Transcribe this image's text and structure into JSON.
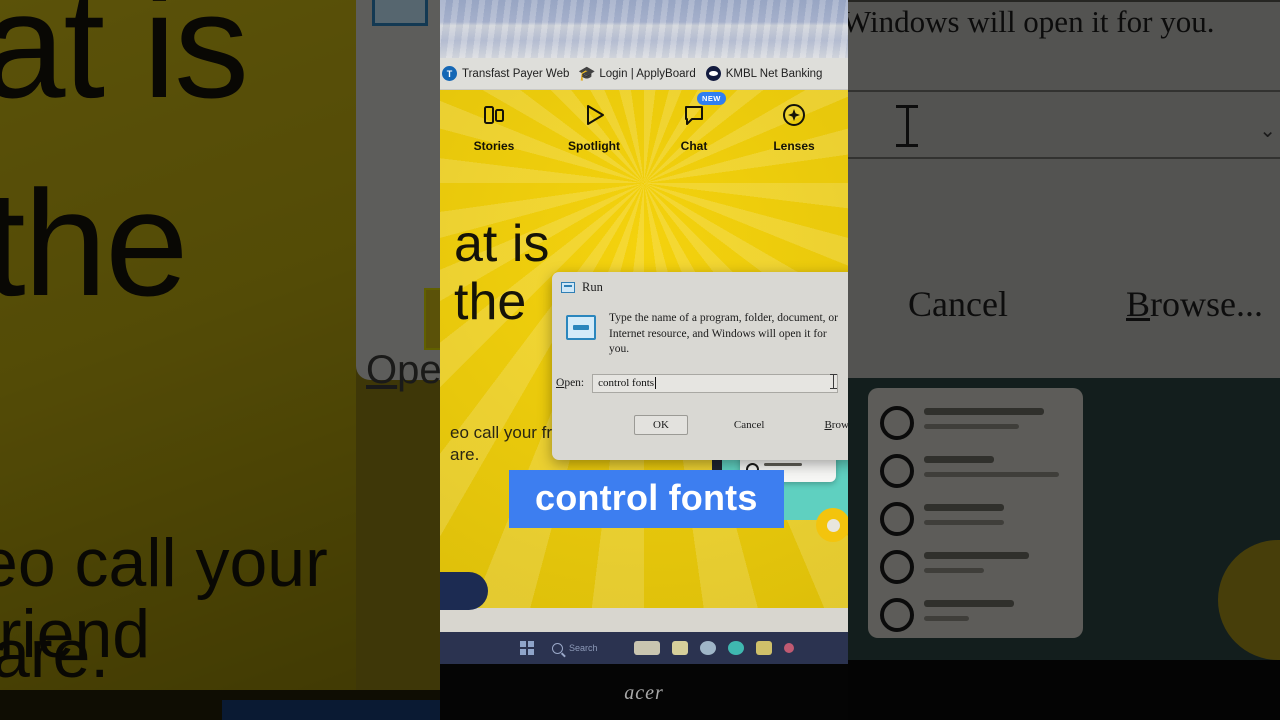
{
  "caption": {
    "text": "control fonts"
  },
  "browser": {
    "bookmarks": [
      {
        "label": "Transfast Payer Web",
        "icon": "transfast-favicon"
      },
      {
        "label": "Login | ApplyBoard",
        "icon": "applyboard-favicon"
      },
      {
        "label": "KMBL Net Banking",
        "icon": "kmbl-favicon"
      }
    ]
  },
  "snapchat": {
    "nav": [
      {
        "label": "Stories",
        "icon": "stories-icon",
        "badge": ""
      },
      {
        "label": "Spotlight",
        "icon": "spotlight-play-icon",
        "badge": ""
      },
      {
        "label": "Chat",
        "icon": "chat-bubble-icon",
        "badge": "NEW"
      },
      {
        "label": "Lenses",
        "icon": "lenses-sparkle-icon",
        "badge": ""
      }
    ],
    "hero_headline_line1": "at is",
    "hero_headline_line2": "the",
    "hero_sub_line1": "eo call your friends",
    "hero_sub_line2": "are.",
    "banner_text": "New! Snap, chat and video call your friends from your browser."
  },
  "run_dialog": {
    "title": "Run",
    "title_icon": "run-window-icon",
    "description_line1": "Type the name of a program, folder, document, or",
    "description_line2": "Internet resource, and Windows will open it for you.",
    "open_label": "Open:",
    "open_value": "control fonts",
    "buttons": {
      "ok": "OK",
      "cancel": "Cancel",
      "browse": "Browse..."
    }
  },
  "taskbar": {
    "start_icon": "windows-start-icon",
    "search_icon": "search-icon",
    "search_placeholder": "Search"
  },
  "laptop": {
    "brand": "acer"
  },
  "side_panels": {
    "left": {
      "word1": "at is",
      "word2": "the",
      "word3": "eo call your friend",
      "word4": "are.",
      "open_label": "Ope"
    },
    "right": {
      "line1": "Windows will open it for you.",
      "cancel": "Cancel",
      "browse": "Browse..."
    }
  },
  "colors": {
    "caption_bg": "#3d7ef0",
    "caption_text": "#ffffff",
    "snap_yellow": "#f4d20d",
    "dialog_bg": "#d9d8d3",
    "accent_blue": "#2f7ff0",
    "taskbar": "#2b3350",
    "mint": "#5fd0c0"
  }
}
